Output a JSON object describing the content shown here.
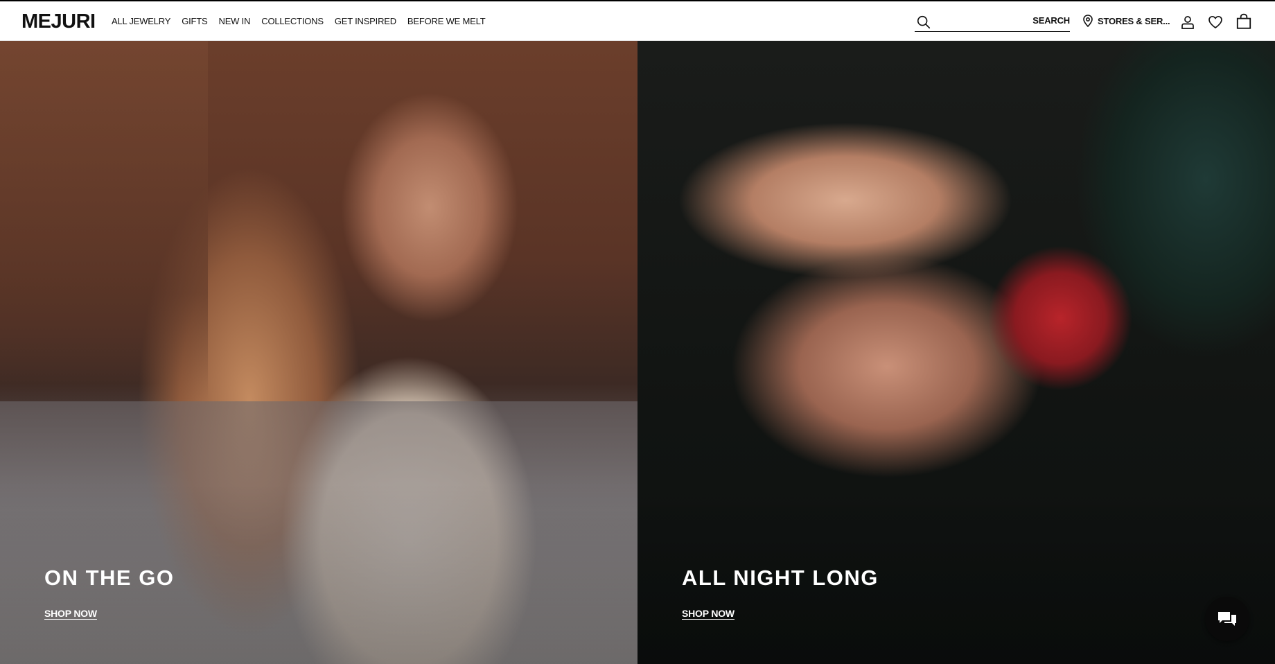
{
  "header": {
    "logo": "MEJURI",
    "nav": [
      "ALL JEWELRY",
      "GIFTS",
      "NEW IN",
      "COLLECTIONS",
      "GET INSPIRED",
      "BEFORE WE MELT"
    ],
    "search": {
      "placeholder": "",
      "label": "SEARCH"
    },
    "stores_label": "STORES & SER...",
    "icons": [
      "search-icon",
      "location-pin-icon",
      "account-icon",
      "wishlist-heart-icon",
      "shopping-bag-icon"
    ]
  },
  "hero": {
    "left": {
      "title": "ON THE GO",
      "cta": "SHOP NOW"
    },
    "right": {
      "title": "ALL NIGHT LONG",
      "cta": "SHOP NOW"
    }
  },
  "chat": {
    "icon": "chat-bubbles-icon"
  },
  "colors": {
    "header_bg": "#ffffff",
    "text": "#111111",
    "hero_text": "#ffffff",
    "chat_bg": "#0a0a0a"
  }
}
